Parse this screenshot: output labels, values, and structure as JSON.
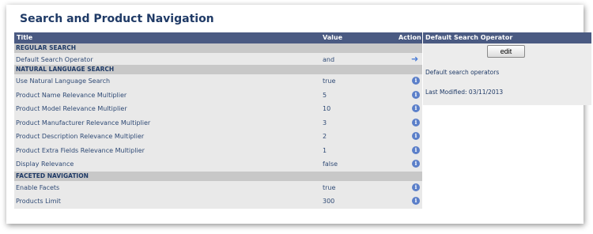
{
  "page": {
    "title": "Search and Product Navigation"
  },
  "table": {
    "headers": {
      "title": "Title",
      "value": "Value",
      "action": "Action"
    },
    "sections": [
      {
        "name": "REGULAR SEARCH",
        "rows": [
          {
            "title": "Default Search Operator",
            "value": "and",
            "action_icon": "arrow-right-icon"
          }
        ]
      },
      {
        "name": "NATURAL LANGUAGE SEARCH",
        "rows": [
          {
            "title": "Use Natural Language Search",
            "value": "true",
            "action_icon": "info-icon"
          },
          {
            "title": "Product Name Relevance Multiplier",
            "value": "5",
            "action_icon": "info-icon"
          },
          {
            "title": "Product Model Relevance Multiplier",
            "value": "10",
            "action_icon": "info-icon"
          },
          {
            "title": "Product Manufacturer Relevance Multiplier",
            "value": "3",
            "action_icon": "info-icon"
          },
          {
            "title": "Product Description Relevance Multiplier",
            "value": "2",
            "action_icon": "info-icon"
          },
          {
            "title": "Product Extra Fields Relevance Multiplier",
            "value": "1",
            "action_icon": "info-icon"
          },
          {
            "title": "Display Relevance",
            "value": "false",
            "action_icon": "info-icon"
          }
        ]
      },
      {
        "name": "FACETED NAVIGATION",
        "rows": [
          {
            "title": "Enable Facets",
            "value": "true",
            "action_icon": "info-icon"
          },
          {
            "title": "Products Limit",
            "value": "300",
            "action_icon": "info-icon"
          }
        ]
      }
    ]
  },
  "side_panel": {
    "header": "Default Search Operator",
    "edit_label": "edit",
    "description": "Default search operators",
    "last_modified": "Last Modified: 03/11/2013"
  },
  "colors": {
    "header_bg": "#4a5a82",
    "section_bg": "#c8c8c8",
    "row_bg": "#e9e9e9",
    "title_text": "#1f3a66",
    "info_icon": "#5b7fc9"
  }
}
